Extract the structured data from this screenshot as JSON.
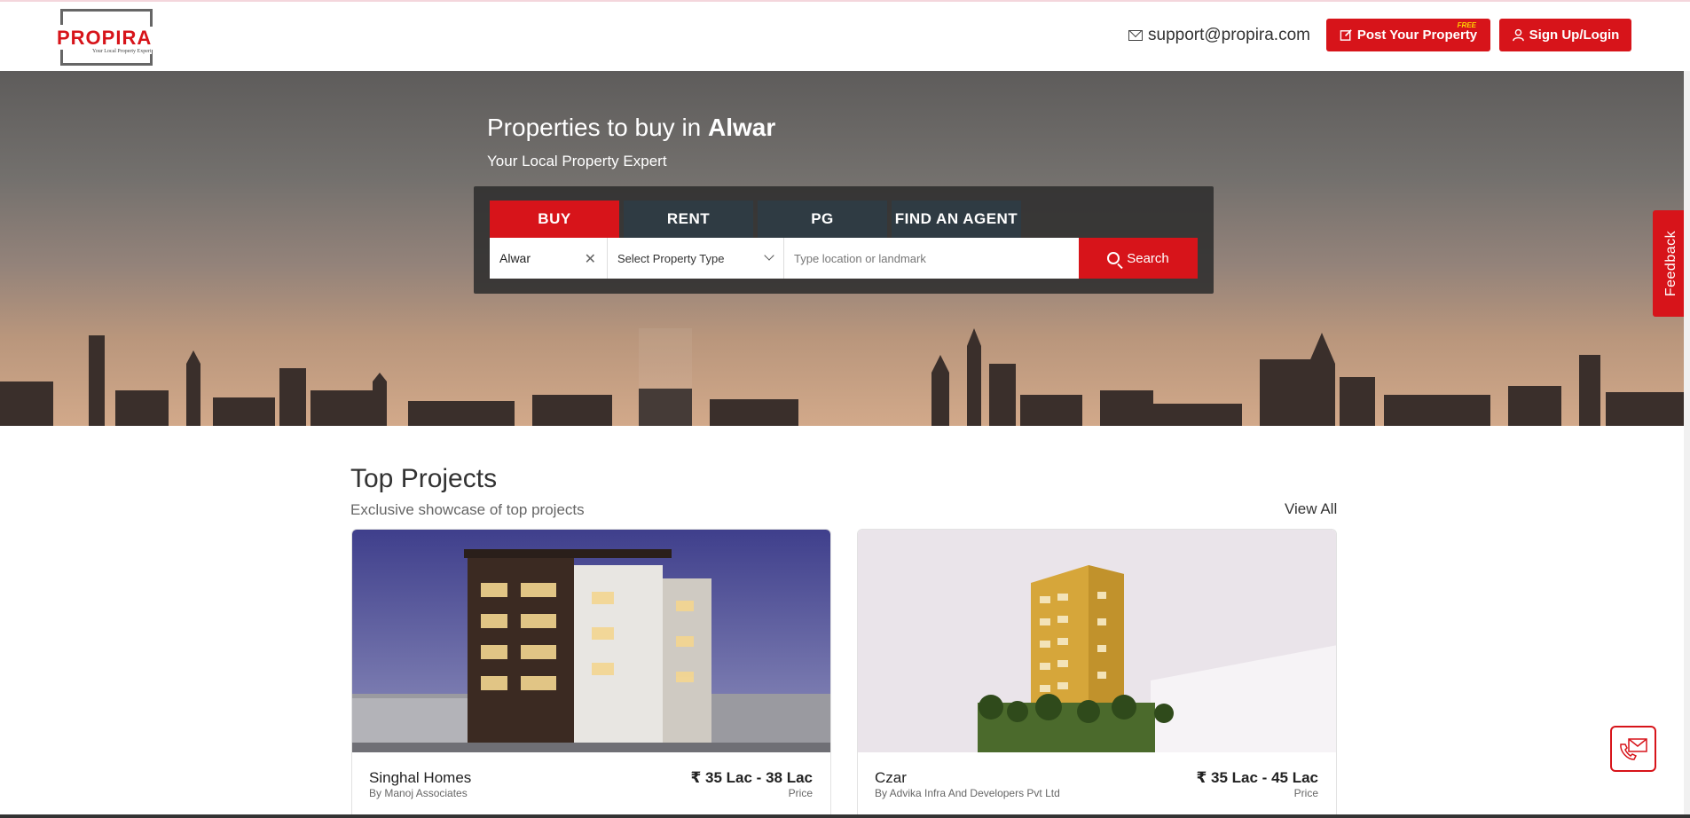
{
  "header": {
    "logo_text": "PROPIRA",
    "logo_tagline": "Your Local Property Expert",
    "support_email": "support@propira.com",
    "post_property_label": "Post Your Property",
    "post_property_badge": "FREE",
    "login_label": "Sign Up/Login"
  },
  "hero": {
    "title_prefix": "Properties to buy in",
    "title_city": "Alwar",
    "subtitle": "Your Local Property Expert",
    "tabs": [
      {
        "label": "BUY",
        "active": true
      },
      {
        "label": "RENT",
        "active": false
      },
      {
        "label": "PG",
        "active": false
      },
      {
        "label": "FIND AN AGENT",
        "active": false
      }
    ],
    "city_value": "Alwar",
    "property_type_selected": "Select Property Type",
    "location_placeholder": "Type location or landmark",
    "search_label": "Search"
  },
  "feedback_label": "Feedback",
  "top_projects": {
    "title": "Top Projects",
    "subtitle": "Exclusive showcase of top projects",
    "view_all": "View All",
    "cards": [
      {
        "name": "Singhal Homes",
        "developer": "By Manoj Associates",
        "price": "₹ 35 Lac - 38 Lac",
        "price_label": "Price"
      },
      {
        "name": "Czar",
        "developer": "By Advika Infra And Developers Pvt Ltd",
        "price": "₹ 35 Lac - 45 Lac",
        "price_label": "Price"
      }
    ]
  },
  "colors": {
    "brand_red": "#d7141a",
    "tab_dark": "#2f3b43"
  }
}
